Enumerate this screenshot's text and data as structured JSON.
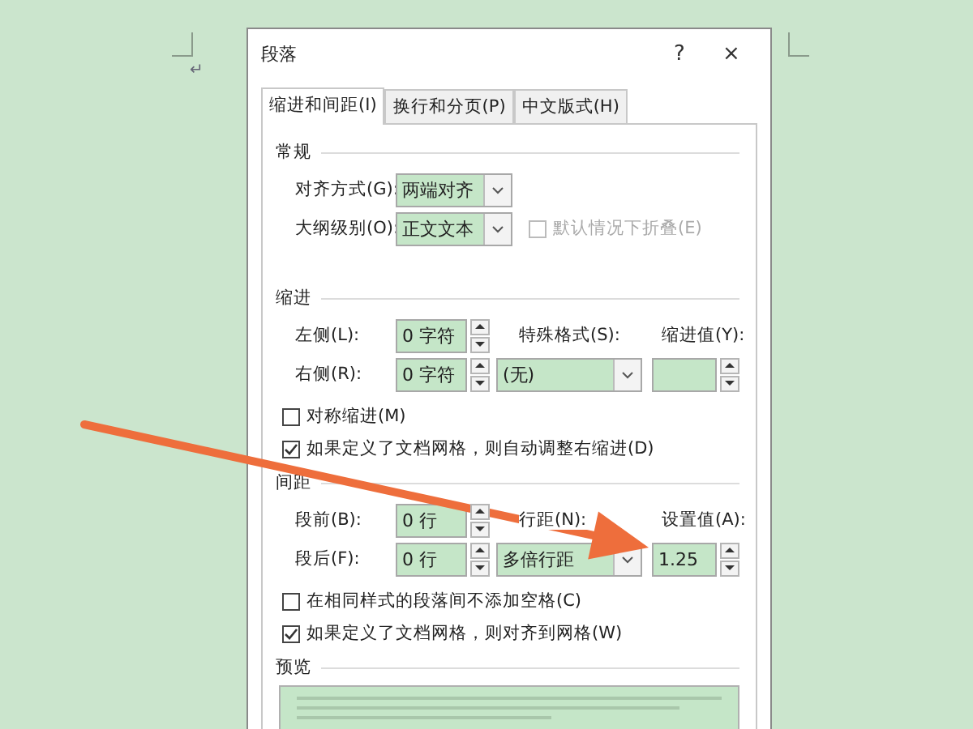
{
  "document": {
    "paragraph_mark": "↵"
  },
  "window": {
    "title": "段落",
    "help": "?",
    "close": "×"
  },
  "tabs": [
    {
      "label": "缩进和间距(I)",
      "selected": true
    },
    {
      "label": "换行和分页(P)",
      "selected": false
    },
    {
      "label": "中文版式(H)",
      "selected": false
    }
  ],
  "general": {
    "heading": "常规",
    "alignment": {
      "label": "对齐方式(G):",
      "value": "两端对齐"
    },
    "outline": {
      "label": "大纲级别(O):",
      "value": "正文文本"
    },
    "collapse": {
      "label": "默认情况下折叠(E)",
      "checked": false,
      "disabled": true
    }
  },
  "indent": {
    "heading": "缩进",
    "left": {
      "label": "左侧(L):",
      "value": "0 字符"
    },
    "right": {
      "label": "右侧(R):",
      "value": "0 字符"
    },
    "special": {
      "label": "特殊格式(S):",
      "value": "(无)"
    },
    "by": {
      "label": "缩进值(Y):"
    },
    "checkboxes": [
      {
        "label": "对称缩进(M)",
        "checked": false
      },
      {
        "label": "如果定义了文档网格，则自动调整右缩进(D)",
        "checked": true
      }
    ]
  },
  "spacing": {
    "heading": "间距",
    "before": {
      "label": "段前(B):",
      "value": "0 行"
    },
    "after": {
      "label": "段后(F):",
      "value": "0 行"
    },
    "line": {
      "label": "行距(N):",
      "value": "多倍行距"
    },
    "at": {
      "label": "设置值(A):",
      "value": "1.25"
    },
    "checkboxes": [
      {
        "label": "在相同样式的段落间不添加空格(C)",
        "checked": false
      },
      {
        "label": "如果定义了文档网格，则对齐到网格(W)",
        "checked": true
      }
    ]
  },
  "preview": {
    "heading": "预览"
  }
}
